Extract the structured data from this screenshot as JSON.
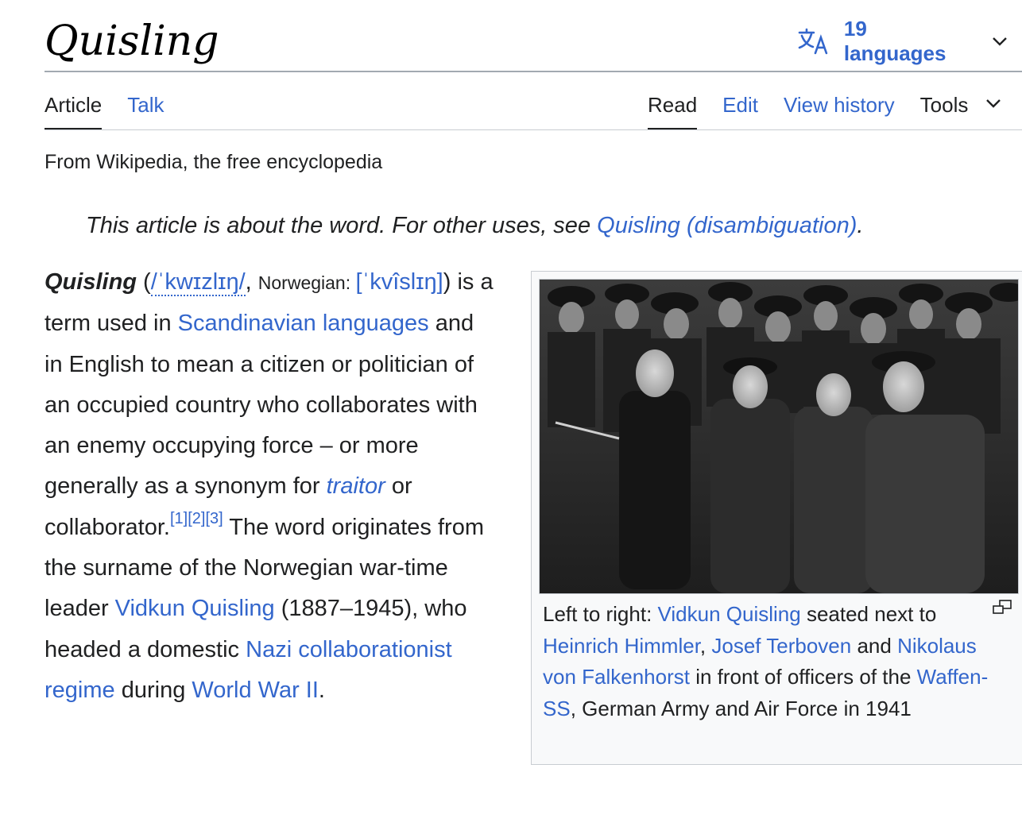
{
  "header": {
    "title": "Quisling",
    "languages_label": "19 languages",
    "language_icon": "translate-icon"
  },
  "tabs": {
    "article": "Article",
    "talk": "Talk",
    "read": "Read",
    "edit": "Edit",
    "view_history": "View history",
    "tools": "Tools"
  },
  "tagline": "From Wikipedia, the free encyclopedia",
  "hatnote": {
    "prefix": "This article is about the word. For other uses, see ",
    "link": "Quisling (disambiguation)",
    "suffix": "."
  },
  "lead": {
    "term": "Quisling",
    "ipa_en": "/ˈkwɪzlɪŋ/",
    "norwegian_label": "Norwegian: ",
    "ipa_no": "[ˈkvîslɪŋ]",
    "t1": " is a term used in ",
    "link_scandinavian": "Scandinavian languages",
    "t2": " and in English to mean a citizen or politician of an occupied country who collaborates with an enemy occupying force – or more generally as a synonym for ",
    "link_traitor": "traitor",
    "t3": " or collaborator.",
    "refs": "[1][2][3]",
    "t4": " The word originates from the surname of the Norwegian war-time leader ",
    "link_vidkun": "Vidkun Quisling",
    "t5": " (1887–1945), who headed a domestic ",
    "link_nazi": "Nazi collaborationist regime",
    "t6": " during ",
    "link_ww2": "World War II",
    "t7": "."
  },
  "infobox": {
    "caption": {
      "c1": "Left to right: ",
      "link_vidkun": "Vidkun Quisling",
      "c2": " seated next to ",
      "link_himmler": "Heinrich Himmler",
      "c3": ", ",
      "link_terboven": "Josef Terboven",
      "c4": " and ",
      "link_falkenhorst": "Nikolaus von Falkenhorst",
      "c5": " in front of officers of the ",
      "link_waffen": "Waffen-SS",
      "c6": ", German Army and Air Force in 1941"
    },
    "enlarge_icon": "enlarge-icon"
  },
  "colors": {
    "link": "#3366cc",
    "text": "#202122",
    "border": "#a2a9b1",
    "thumb_bg": "#f8f9fa"
  }
}
